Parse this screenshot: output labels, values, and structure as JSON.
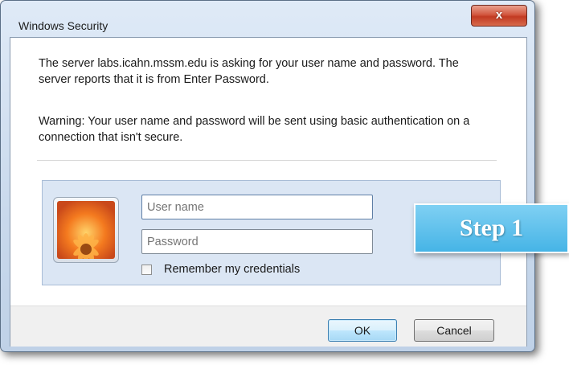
{
  "window": {
    "title": "Windows Security",
    "close_label": "x"
  },
  "message": {
    "line1": "The server labs.icahn.mssm.edu is asking for your user name and password. The server reports that it is from Enter Password.",
    "line2": "Warning: Your user name and password will be sent using basic authentication on a connection that isn't secure."
  },
  "credentials": {
    "avatar_icon": "flower-user-tile-icon",
    "username": {
      "placeholder": "User name",
      "value": ""
    },
    "password": {
      "placeholder": "Password",
      "value": ""
    },
    "remember_label": "Remember my credentials",
    "remember_checked": false
  },
  "buttons": {
    "ok_label": "OK",
    "cancel_label": "Cancel"
  },
  "callout": {
    "label": "Step 1",
    "color": "#46b4e6"
  }
}
